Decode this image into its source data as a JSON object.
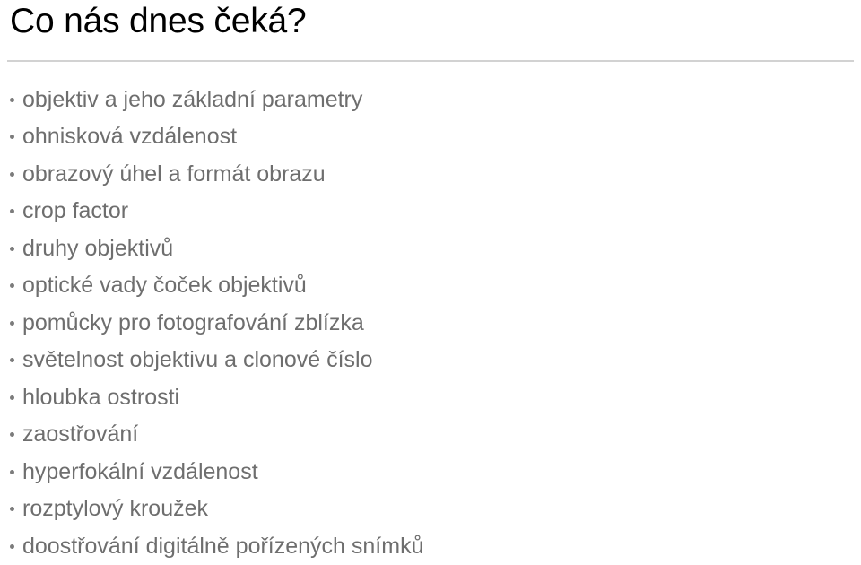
{
  "slide": {
    "title": "Co nás dnes čeká?",
    "divider": true,
    "colors": {
      "background": "#ffffff",
      "title_text": "#000000",
      "body_text": "#6e6e6e",
      "bullet_dot": "#7c7c7c",
      "divider": "#d2d2d2"
    },
    "bullets": [
      {
        "label": "objektiv a jeho základní parametry"
      },
      {
        "label": "ohnisková vzdálenost"
      },
      {
        "label": "obrazový úhel a formát obrazu"
      },
      {
        "label": "crop factor"
      },
      {
        "label": "druhy objektivů"
      },
      {
        "label": "optické vady čoček objektivů"
      },
      {
        "label": "pomůcky pro fotografování zblízka"
      },
      {
        "label": "světelnost objektivu a clonové číslo"
      },
      {
        "label": "hloubka ostrosti"
      },
      {
        "label": "zaostřování"
      },
      {
        "label": "hyperfokální vzdálenost"
      },
      {
        "label": "rozptylový kroužek"
      },
      {
        "label": "doostřování digitálně pořízených snímků"
      }
    ]
  }
}
